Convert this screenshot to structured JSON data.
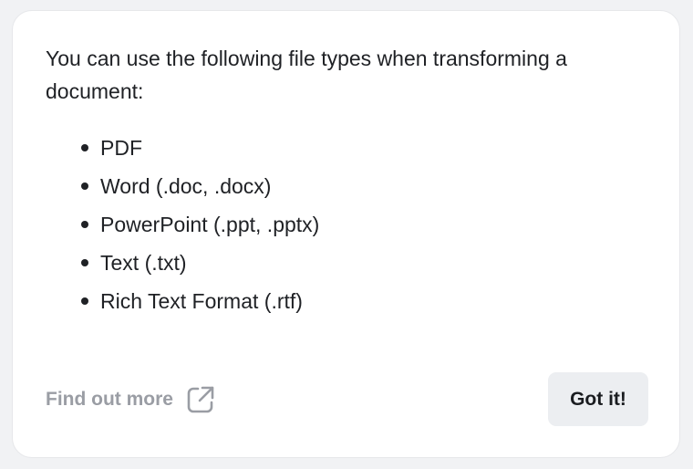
{
  "dialog": {
    "intro_text": "You can use the following file types when transforming a document:",
    "file_types": [
      "PDF",
      "Word (.doc, .docx)",
      "PowerPoint (.ppt, .pptx)",
      "Text (.txt)",
      "Rich Text Format (.rtf)"
    ],
    "find_out_more_label": "Find out more",
    "find_out_more_icon": "external-link-icon",
    "confirm_label": "Got it!"
  },
  "colors": {
    "text": "#1f2125",
    "muted_link": "#9a9da4",
    "button_bg": "#eceef1",
    "card_bg": "#ffffff",
    "page_bg": "#f1f2f4"
  }
}
